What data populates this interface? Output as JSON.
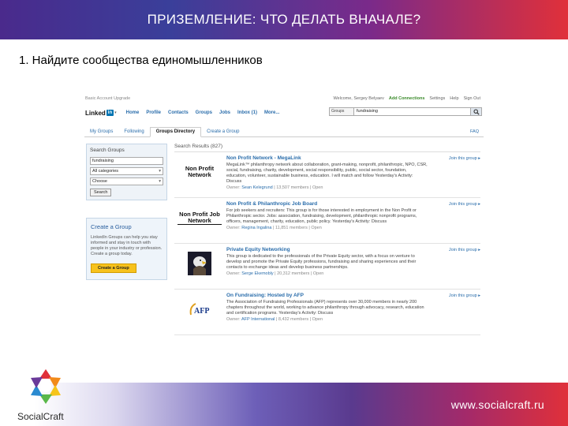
{
  "slide": {
    "title": "ПРИЗЕМЛЕНИЕ: ЧТО ДЕЛАТЬ ВНАЧАЛЕ?",
    "subtitle": "1. Найдите сообщества единомышленников",
    "footer_url": "www.socialcraft.ru",
    "brand_name": "SocialCraft",
    "colors": {
      "header_start": "#4a2a8c",
      "header_end": "#e0303a",
      "linkedin_blue": "#0073b1",
      "link": "#2a6dab",
      "button_yellow": "#f7c21c"
    }
  },
  "linkedin": {
    "util_left": "Basic Account  Upgrade",
    "util_right": {
      "user": "Welcome, Sergey Belyaev",
      "upgrade": "Add Connections",
      "settings": "Settings",
      "help": "Help",
      "signout": "Sign Out"
    },
    "logo": {
      "text": "Linked",
      "in": "in",
      "icon": "linkedin-logo"
    },
    "nav": [
      "Home",
      "Profile",
      "Contacts",
      "Groups",
      "Jobs",
      "Inbox (1)",
      "More..."
    ],
    "search": {
      "scope": "Groups",
      "query": "fundraising",
      "icon": "search-icon"
    },
    "tabs": [
      "My Groups",
      "Following",
      "Groups Directory",
      "Create a Group"
    ],
    "faq": "FAQ",
    "search_groups": {
      "title": "Search Groups",
      "keyword": "fundraising",
      "category": "All categories",
      "language": "Choose",
      "button": "Search"
    },
    "create_group": {
      "title": "Create a Group",
      "body": "LinkedIn Groups can help you stay informed and stay in touch with people in your industry or profession. Create a group today.",
      "button": "Create a Group"
    },
    "results_header": "Search Results (827)",
    "join_label": "Join this group",
    "results": [
      {
        "logo": "Non Profit Network",
        "title": "Non Profit Network - MegaLink",
        "desc": "MegaLink™ philanthropy network about collaboration, grant-making, nonprofit, philanthropic, NPO, CSR, social, fundraising, charity, development, social responsibility, public, social sector, foundation, education, volunteer, sustainable business, education. I will match and follow Yesterday's Activity: Discuss",
        "owner_label": "Owner:",
        "owner": "Sean Kelegrund",
        "meta": "13,507 members | Open"
      },
      {
        "logo": "Non Profit Job Network",
        "title": "Non Profit & Philanthropic Job Board",
        "desc": "For job seekers and recruiters: This group is for those interested in employment in the Non Profit or Philanthropic sector. Jobs: association, fundraising, development, philanthropic nonprofit programs, officers, management, charity, education, public policy. Yesterday's Activity: Discuss",
        "owner_label": "Owner:",
        "owner": "Regina Ingalina",
        "meta": "11,851 members | Open"
      },
      {
        "logo": "eagle",
        "title": "Private Equity Networking",
        "desc": "This group is dedicated to the professionals of the Private Equity sector, with a focus on venture to develop and promote the Private Equity professions, fundraising and sharing experiences and their contacts to exchange ideas and develop business partnerships.",
        "owner_label": "Owner:",
        "owner": "Serge Ekemobly",
        "meta": "20,312 members | Open"
      },
      {
        "logo": "AFP",
        "title": "On Fundraising: Hosted by AFP",
        "desc": "The Association of Fundraising Professionals (AFP) represents over 30,000 members in nearly 200 chapters throughout the world, working to advance philanthropy through advocacy, research, education and certification programs. Yesterday's Activity: Discuss",
        "owner_label": "Owner:",
        "owner": "AFP International",
        "meta": "8,432 members | Open"
      }
    ]
  }
}
